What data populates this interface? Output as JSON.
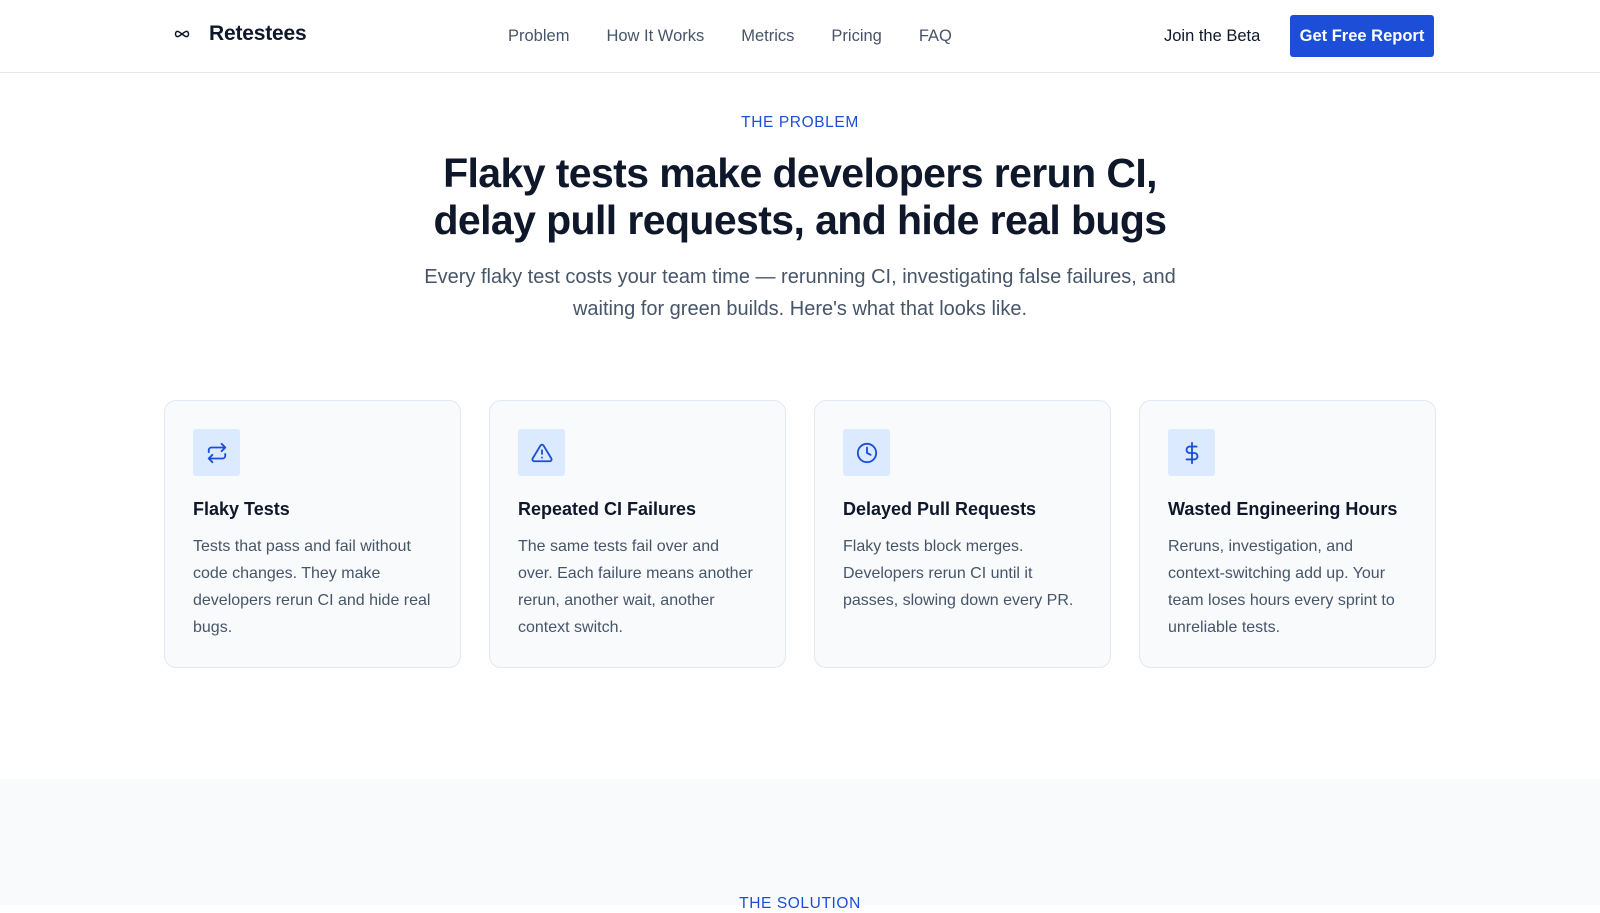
{
  "nav": {
    "brand": "Retestees",
    "brand_icon": "infinity-icon",
    "links": [
      "Problem",
      "How It Works",
      "Metrics",
      "Pricing",
      "FAQ"
    ],
    "join_label": "Join the Beta",
    "cta_label": "Get Free Report",
    "accent_color": "#1d4ed8"
  },
  "problem": {
    "eyebrow": "THE PROBLEM",
    "headline_line1": "Flaky tests make developers rerun CI,",
    "headline_line2": "delay pull requests, and hide real bugs",
    "subtext_line1": "Every flaky test costs your team time — rerunning CI, investigating false failures, and",
    "subtext_line2": "waiting for green builds. Here's what that looks like."
  },
  "cards": [
    {
      "icon": "repeat-arrows-icon",
      "title": "Flaky Tests",
      "description": "Tests that pass and fail without code changes. They make developers rerun CI and hide real bugs."
    },
    {
      "icon": "warning-triangle-icon",
      "title": "Repeated CI Failures",
      "description": "The same tests fail over and over. Each failure means another rerun, another wait, another context switch."
    },
    {
      "icon": "clock-icon",
      "title": "Delayed Pull Requests",
      "description": "Flaky tests block merges. Developers rerun CI until it passes, slowing down every PR."
    },
    {
      "icon": "dollar-sign-icon",
      "title": "Wasted Engineering Hours",
      "description": "Reruns, investigation, and context-switching add up. Your team loses hours every sprint to unreliable tests."
    }
  ],
  "solution": {
    "eyebrow": "THE SOLUTION"
  }
}
